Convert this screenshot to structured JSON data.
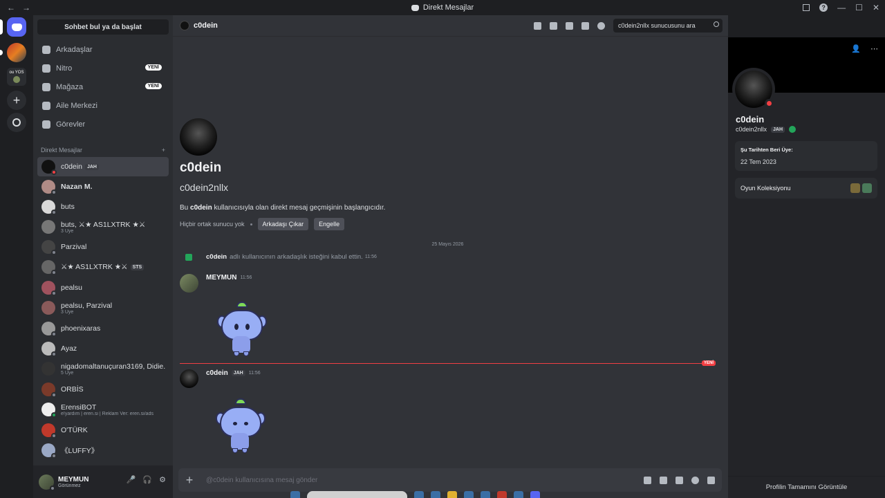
{
  "window": {
    "title": "Direkt Mesajlar",
    "nav_back": "←",
    "nav_forward": "→",
    "controls": [
      "—",
      "☐",
      "✕"
    ]
  },
  "rail": {
    "folder_label": "ou YOS"
  },
  "sidebar": {
    "search_label": "Sohbet bul ya da başlat",
    "nav": [
      {
        "label": "Arkadaşlar",
        "icon": "friends-icon"
      },
      {
        "label": "Nitro",
        "icon": "nitro-icon",
        "badge": "YENİ"
      },
      {
        "label": "Mağaza",
        "icon": "shop-icon",
        "badge": "YENİ"
      },
      {
        "label": "Aile Merkezi",
        "icon": "family-icon"
      },
      {
        "label": "Görevler",
        "icon": "quests-icon"
      }
    ],
    "dm_header": "Direkt Mesajlar",
    "dm_add": "+",
    "dms": [
      {
        "name": "c0dein",
        "tag": "JAH",
        "status": "dnd"
      },
      {
        "name": "Nazan M.",
        "status": "offline"
      },
      {
        "name": "buts",
        "status": "offline"
      },
      {
        "name": "buts, ⚔★ AS1LXTRK ★⚔",
        "sub": "3 Üye"
      },
      {
        "name": "Parzival",
        "status": "offline"
      },
      {
        "name": "⚔★ AS1LXTRK ★⚔",
        "tag": "STS",
        "status": "offline"
      },
      {
        "name": "pealsu",
        "status": "offline"
      },
      {
        "name": "pealsu, Parzival",
        "sub": "3 Üye"
      },
      {
        "name": "phoenixaras",
        "status": "offline"
      },
      {
        "name": "Ayaz",
        "status": "offline"
      },
      {
        "name": "nigadomaltanuçuran3169, Didie...",
        "sub": "5 Üye"
      },
      {
        "name": "ORBİS",
        "status": "offline"
      },
      {
        "name": "ErensiBOT",
        "sub": "e!yardım | eren.si | Reklam Ver: eren.si/ads",
        "status": "online"
      },
      {
        "name": "O'TÜRK",
        "status": "offline"
      },
      {
        "name": "《LUFFY》",
        "status": "offline"
      }
    ]
  },
  "user_panel": {
    "name": "MEYMUN",
    "status": "Görünmez"
  },
  "chat": {
    "header_name": "c0dein",
    "search_placeholder": "c0dein2nllx sunucusunu ara",
    "intro": {
      "display_name": "c0dein",
      "username": "c0dein2nllx",
      "desc_prefix": "Bu",
      "desc_name": "c0dein",
      "desc_suffix": "kullanıcısıyla olan direkt mesaj geçmişinin başlangıcıdır.",
      "no_mutual": "Hiçbir ortak sunucu yok",
      "remove_friend": "Arkadaşı Çıkar",
      "block": "Engelle"
    },
    "date_divider": "25 Mayıs 2026",
    "system_message": {
      "name": "c0dein",
      "text": "adlı kullanıcının arkadaşlık isteğini kabul ettin.",
      "time": "11:56"
    },
    "messages": [
      {
        "author": "MEYMUN",
        "time": "11:56"
      },
      {
        "author": "c0dein",
        "tag": "JAH",
        "time": "11:56"
      }
    ],
    "new_label": "YENİ",
    "composer_placeholder": "@c0dein kullanıcısına mesaj gönder"
  },
  "profile": {
    "display_name": "c0dein",
    "username": "c0dein2nllx",
    "tag": "JAH",
    "member_since_title": "Şu Tarihten Beri Üye:",
    "member_since": "22 Tem 2023",
    "game_collection": "Oyun Koleksiyonu",
    "view_full": "Profilin Tamamını Görüntüle"
  },
  "colors": {
    "accent": "#5865f2",
    "dnd": "#f23f43",
    "online": "#23a55a",
    "background": "#313338"
  }
}
